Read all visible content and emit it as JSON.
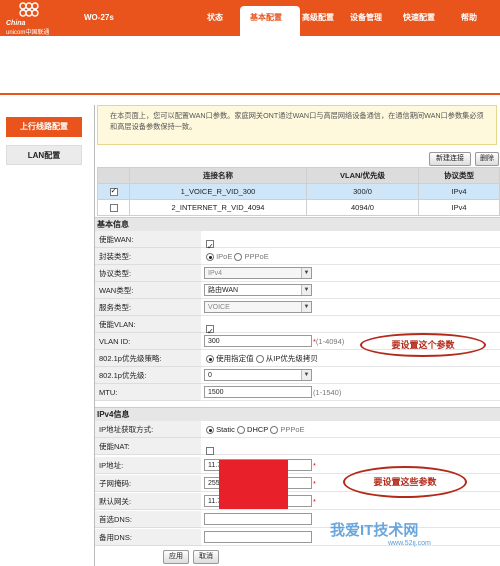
{
  "brand": {
    "line1": "China",
    "line2": "unicom中国联通",
    "model": "WO-27s"
  },
  "nav": [
    {
      "label": "状态"
    },
    {
      "label": "基本配置"
    },
    {
      "label": "高级配置"
    },
    {
      "label": "设备管理"
    },
    {
      "label": "快速配置"
    },
    {
      "label": "帮助"
    }
  ],
  "sidebar": {
    "items": [
      {
        "label": "上行线路配置"
      },
      {
        "label": "LAN配置"
      }
    ]
  },
  "notice": "在本页面上，您可以配置WAN口参数。家庭网关ONT通过WAN口与高层网络设备通信，在通信期间WAN口参数集必须和高层设备参数保持一致。",
  "toolbar": {
    "new": "新建连接",
    "delete": "删除"
  },
  "wan_table": {
    "headers": [
      "",
      "连接名称",
      "VLAN/优先级",
      "协议类型"
    ],
    "rows": [
      {
        "checked": true,
        "name": "1_VOICE_R_VID_300",
        "vlan": "300/0",
        "proto": "IPv4"
      },
      {
        "checked": false,
        "name": "2_INTERNET_R_VID_4094",
        "vlan": "4094/0",
        "proto": "IPv4"
      }
    ]
  },
  "basic": {
    "title": "基本信息",
    "enable_wan": "使能WAN:",
    "encap": "封装类型:",
    "encap_opt1": "IPoE",
    "encap_opt2": "PPPoE",
    "protocol": "协议类型:",
    "protocol_val": "IPv4",
    "wan_type": "WAN类型:",
    "wan_type_val": "路由WAN",
    "service": "服务类型:",
    "service_val": "VOICE",
    "enable_vlan": "使能VLAN:",
    "vlan_id": "VLAN ID:",
    "vlan_id_val": "300",
    "vlan_range": "(1-4094)",
    "prio_policy": "802.1p优先级策略:",
    "prio_policy_opt1": "使用指定值",
    "prio_policy_opt2": "从IP优先级拷贝",
    "prio": "802.1p优先级:",
    "prio_val": "0",
    "mtu": "MTU:",
    "mtu_val": "1500",
    "mtu_range": "(1-1540)"
  },
  "ipv4": {
    "title": "IPv4信息",
    "method": "IP地址获取方式:",
    "opt_static": "Static",
    "opt_dhcp": "DHCP",
    "opt_pppoe": "PPPoE",
    "nat": "使能NAT:",
    "ip": "IP地址:",
    "ip_val": "11.7",
    "mask": "子网掩码:",
    "mask_val": "255",
    "gateway": "默认网关:",
    "gateway_val": "11.7",
    "dns1": "首选DNS:",
    "dns2": "备用DNS:"
  },
  "actions": {
    "apply": "应用",
    "cancel": "取消"
  },
  "annotations": {
    "a1": "要设置这个参数",
    "a2": "要设置这些参数"
  },
  "watermark": {
    "main": "我爱IT技术网",
    "sub": "www.52ij.com"
  },
  "colors": {
    "brand": "#e8541c",
    "annotation": "#b32a1a",
    "redact": "#e8202a",
    "watermark": "#3a8ad1"
  }
}
